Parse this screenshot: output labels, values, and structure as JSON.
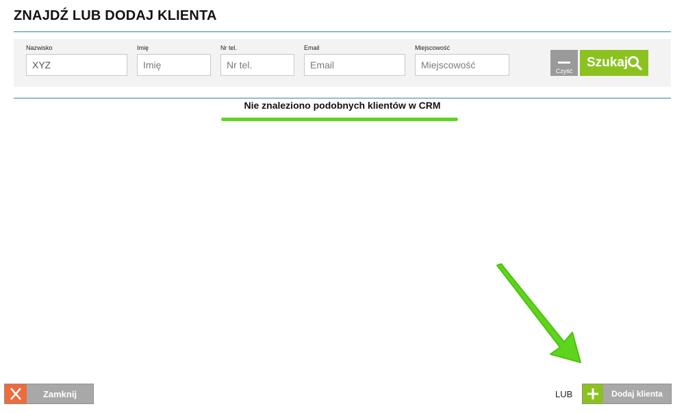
{
  "page": {
    "title": "ZNAJDŹ LUB DODAJ KLIENTA"
  },
  "filters": {
    "nazwisko": {
      "label": "Nazwisko",
      "value": "XYZ",
      "placeholder": "Nazwisko"
    },
    "imie": {
      "label": "Imię",
      "value": "",
      "placeholder": "Imię"
    },
    "phone": {
      "label": "Nr tel.",
      "value": "",
      "placeholder": "Nr tel."
    },
    "email": {
      "label": "Email",
      "value": "",
      "placeholder": "Email"
    },
    "city": {
      "label": "Miejscowość",
      "value": "",
      "placeholder": "Miejscowość"
    }
  },
  "actions": {
    "clear_label": "Czyść",
    "search_label": "Szukaj"
  },
  "results": {
    "message": "Nie znaleziono podobnych klientów w CRM"
  },
  "footer": {
    "close_label": "Zamknij",
    "or_label": "LUB",
    "add_label": "Dodaj klienta"
  },
  "colors": {
    "accent_green": "#8cc21f",
    "highlight_green": "#5fd41d",
    "close_orange": "#ee6b3b",
    "rule_blue": "#2f7fc1"
  },
  "icons": [
    "search-icon",
    "close-icon",
    "plus-icon",
    "arrow-annotation-icon"
  ]
}
